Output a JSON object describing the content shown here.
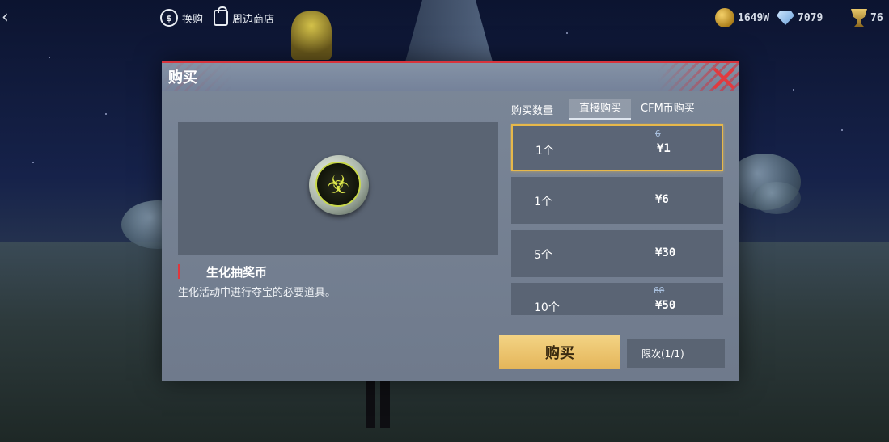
{
  "topbar": {
    "exchange_label": "换购",
    "exchange_icon_text": "$",
    "shop_label": "周边商店",
    "gold_amount": "1649W",
    "diamond_amount": "7079",
    "trophy_amount": "76"
  },
  "dialog": {
    "title": "购买",
    "item": {
      "name": "生化抽奖币",
      "description": "生化活动中进行夺宝的必要道具。",
      "icon_glyph": "☣"
    },
    "quantity_label": "购买数量",
    "tabs": [
      {
        "label": "直接购买",
        "active": true
      },
      {
        "label": "CFM币购买",
        "active": false
      }
    ],
    "options": [
      {
        "qty": "1个",
        "price": "¥1",
        "old_price": "6",
        "selected": true
      },
      {
        "qty": "1个",
        "price": "¥6",
        "old_price": "",
        "selected": false
      },
      {
        "qty": "5个",
        "price": "¥30",
        "old_price": "",
        "selected": false
      },
      {
        "qty": "10个",
        "price": "¥50",
        "old_price": "60",
        "selected": false
      }
    ],
    "buy_label": "购买",
    "limit_label": "限次(1/1)"
  },
  "colors": {
    "accent_red": "#e0363c",
    "selected_border": "#e7b84a",
    "buy_button": "#e9c06a"
  }
}
